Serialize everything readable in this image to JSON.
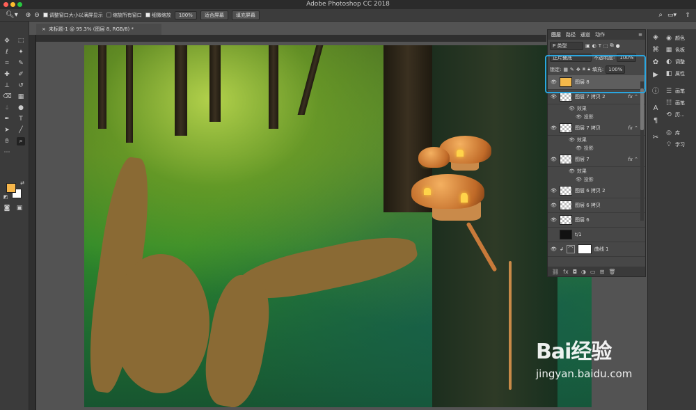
{
  "app": {
    "title": "Adobe Photoshop CC 2018"
  },
  "window_controls": {
    "close_color": "#ff5f57",
    "min_color": "#febc2e",
    "max_color": "#28c840"
  },
  "options_bar": {
    "tool_icon": "zoom-icon",
    "checkbox_resize": {
      "label": "调整窗口大小以满屏显示",
      "checked": true
    },
    "checkbox_zoom_all": {
      "label": "缩放所有窗口",
      "checked": false
    },
    "checkbox_scrubby": {
      "label": "细微缩放",
      "checked": true
    },
    "zoom_value": "100%",
    "fit_screen": "适合屏幕",
    "fill_screen": "填充屏幕"
  },
  "document": {
    "tab_title": "未标题-1 @ 95.3% (图层 8, RGB/8) *"
  },
  "colors": {
    "foreground": "#f6b64a",
    "background": "#ffffff",
    "highlight": "#2aa6e0"
  },
  "layers_panel": {
    "tabs": [
      "图层",
      "路径",
      "通道",
      "动作"
    ],
    "filter_kind": "P 类型",
    "blend_mode": "正片叠底",
    "opacity_label": "不透明度:",
    "opacity_value": "100%",
    "lock_label": "锁定:",
    "fill_label": "填充:",
    "fill_value": "100%",
    "layers": [
      {
        "name": "图层 8",
        "selected": true,
        "fx": false
      },
      {
        "name": "图层 7 拷贝 2",
        "selected": false,
        "fx": true,
        "effects_label": "效果",
        "effect": "投影"
      },
      {
        "name": "图层 7 拷贝",
        "selected": false,
        "fx": true,
        "effects_label": "效果",
        "effect": "投影"
      },
      {
        "name": "图层 7",
        "selected": false,
        "fx": true,
        "effects_label": "效果",
        "effect": "投影"
      },
      {
        "name": "图层 6 拷贝 2",
        "selected": false,
        "fx": false
      },
      {
        "name": "图层 6 拷贝",
        "selected": false,
        "fx": false
      },
      {
        "name": "图层 6",
        "selected": false,
        "fx": false
      },
      {
        "name": "t/1",
        "selected": false,
        "fx": false
      },
      {
        "name": "曲线 1",
        "selected": false,
        "fx": false
      }
    ]
  },
  "right_panel": {
    "items": [
      {
        "icon": "color-icon",
        "label": "颜色"
      },
      {
        "icon": "swatches-icon",
        "label": "色板"
      },
      {
        "icon": "adjustments-icon",
        "label": "调整"
      },
      {
        "icon": "properties-icon",
        "label": "属性"
      },
      {
        "icon": "paragraph-icon",
        "label": "画笔"
      },
      {
        "icon": "brush-icon",
        "label": "画笔"
      },
      {
        "icon": "history-icon",
        "label": "历..."
      },
      {
        "icon": "library-icon",
        "label": "库"
      },
      {
        "icon": "learn-icon",
        "label": "学习"
      }
    ]
  },
  "watermark": {
    "brand": "Bai经验",
    "url": "jingyan.baidu.com"
  }
}
